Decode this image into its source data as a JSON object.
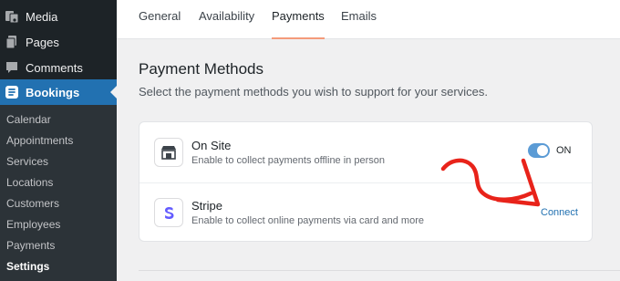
{
  "sidebar": {
    "menu": [
      {
        "label": "Media",
        "icon": "media-icon"
      },
      {
        "label": "Pages",
        "icon": "pages-icon"
      },
      {
        "label": "Comments",
        "icon": "comments-icon"
      },
      {
        "label": "Bookings",
        "icon": "bookings-icon"
      }
    ],
    "submenu": [
      "Calendar",
      "Appointments",
      "Services",
      "Locations",
      "Customers",
      "Employees",
      "Payments",
      "Settings"
    ]
  },
  "tabs": [
    "General",
    "Availability",
    "Payments",
    "Emails"
  ],
  "main": {
    "heading": "Payment Methods",
    "subheading": "Select the payment methods you wish to support for your services."
  },
  "methods": [
    {
      "title": "On Site",
      "description": "Enable to collect payments offline in person",
      "toggle_label": "ON",
      "icon": "store-icon"
    },
    {
      "title": "Stripe",
      "description": "Enable to collect online payments via card and more",
      "action_label": "Connect",
      "icon": "stripe-icon"
    }
  ],
  "colors": {
    "sidebar_bg": "#1d2327",
    "submenu_bg": "#2c3338",
    "active_menu": "#2271b1",
    "tab_underline": "#f49b7a",
    "link": "#2271b1",
    "toggle_on": "#5b9bd5",
    "stripe_brand": "#635bff",
    "annotation_arrow": "#e8231a"
  }
}
